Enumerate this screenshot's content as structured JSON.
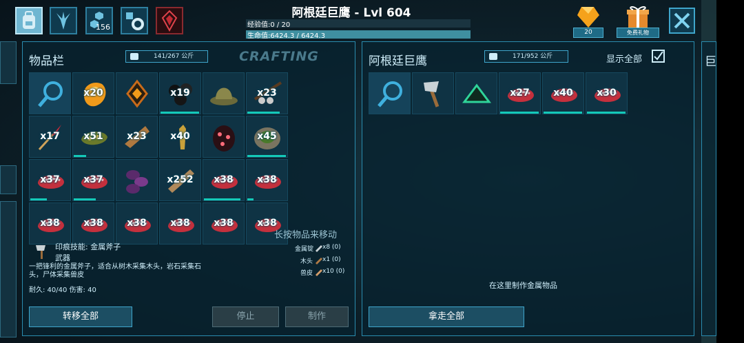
{
  "header": {
    "title": "阿根廷巨鹰 - Lvl 604",
    "xp_label": "经验值:0 / 20",
    "xp_fraction": 0,
    "health_label": "生命值:6424.3 / 6424.3",
    "health_fraction": 1,
    "tab_badge_count": "156",
    "gem_count": "20",
    "gift_label": "免费礼物",
    "colors": {
      "accent": "#2a8db0",
      "highlight": "#14c9b8",
      "panel": "#08232f"
    }
  },
  "inventory": {
    "title": "物品栏",
    "weight": "141/267 公斤",
    "crafting_tab": "CRAFTING",
    "slots": [
      {
        "icon": "search-icon",
        "qty": ""
      },
      {
        "icon": "amber-icon",
        "qty": "x20"
      },
      {
        "icon": "diamond-icon",
        "qty": ""
      },
      {
        "icon": "black-pearl-icon",
        "qty": "x19",
        "durability": 0.95
      },
      {
        "icon": "hat-icon",
        "qty": ""
      },
      {
        "icon": "slingshot-icon",
        "qty": "x23",
        "durability": 0.8
      },
      {
        "icon": "feather-dart-icon",
        "qty": "x17"
      },
      {
        "icon": "hide-icon",
        "qty": "x51",
        "durability": 0.3
      },
      {
        "icon": "leather-icon",
        "qty": "x23"
      },
      {
        "icon": "bullet-icon",
        "qty": "x40"
      },
      {
        "icon": "egg-icon",
        "qty": ""
      },
      {
        "icon": "stone-bowl-icon",
        "qty": "x45",
        "durability": 0.95
      },
      {
        "icon": "meat-icon",
        "qty": "x37",
        "durability": 0.4
      },
      {
        "icon": "meat-icon",
        "qty": "x37",
        "durability": 0.55
      },
      {
        "icon": "berries-icon",
        "qty": ""
      },
      {
        "icon": "wood-icon",
        "qty": "x252"
      },
      {
        "icon": "meat-icon",
        "qty": "x38",
        "durability": 0.9
      },
      {
        "icon": "meat-icon",
        "qty": "x38",
        "durability": 0.15
      },
      {
        "icon": "meat-icon",
        "qty": "x38"
      },
      {
        "icon": "meat-icon",
        "qty": "x38"
      },
      {
        "icon": "meat-icon",
        "qty": "x38"
      },
      {
        "icon": "meat-icon",
        "qty": "x38"
      },
      {
        "icon": "meat-icon",
        "qty": "x38"
      },
      {
        "icon": "meat-icon",
        "qty": "x38"
      }
    ],
    "hint": "长按物品来移动",
    "selected_item": {
      "name": "印痕技能: 金属斧子",
      "type": "武器",
      "description": "一把锋利的金属斧子，适合从树木采集木头，岩石采集石头，尸体采集兽皮",
      "durability_damage": "耐久: 40/40 伤害: 40"
    },
    "requirements": [
      {
        "name": "金属锭",
        "qty": "x8 (0)"
      },
      {
        "name": "木头",
        "qty": "x1 (0)"
      },
      {
        "name": "兽皮",
        "qty": "x10 (0)"
      }
    ],
    "buttons": {
      "transfer_all": "转移全部",
      "stop": "停止",
      "craft": "制作"
    }
  },
  "remote": {
    "title": "阿根廷巨鹰",
    "weight": "171/952 公斤",
    "show_all": "显示全部",
    "show_all_checked": true,
    "slots": [
      {
        "icon": "search-icon",
        "qty": ""
      },
      {
        "icon": "metal-hatchet-icon",
        "qty": ""
      },
      {
        "icon": "triangle-icon",
        "qty": ""
      },
      {
        "icon": "meat-icon",
        "qty": "x27",
        "durability": 0.95
      },
      {
        "icon": "meat-icon",
        "qty": "x40",
        "durability": 0.95
      },
      {
        "icon": "meat-icon",
        "qty": "x30",
        "durability": 0.95
      }
    ],
    "craft_hint": "在这里制作金属物品",
    "take_all": "拿走全部"
  },
  "right_edge_glyph": "巨"
}
